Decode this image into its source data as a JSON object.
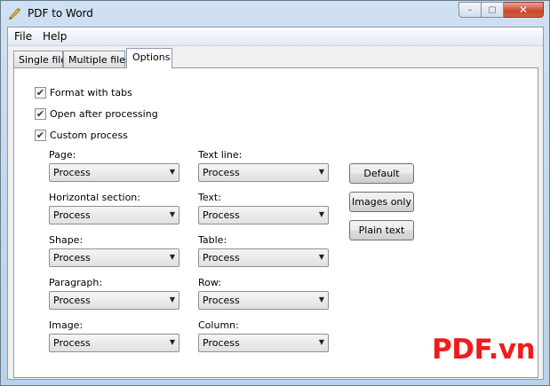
{
  "window": {
    "title": "PDF to Word"
  },
  "window_controls": {
    "minimize": "–",
    "maximize": "▢",
    "close": "✕"
  },
  "menu": {
    "file": "File",
    "help": "Help"
  },
  "tabs": [
    {
      "label": "Single file"
    },
    {
      "label": "Multiple files"
    },
    {
      "label": "Options",
      "active": true
    }
  ],
  "options": {
    "format_with_tabs": {
      "label": "Format with tabs",
      "checked": true
    },
    "open_after_processing": {
      "label": "Open after processing",
      "checked": true
    },
    "custom_process": {
      "label": "Custom process",
      "checked": true
    }
  },
  "check_mark": "✔",
  "combo_arrow": "▼",
  "fields_left": [
    {
      "label": "Page:",
      "value": "Process"
    },
    {
      "label": "Horizontal section:",
      "value": "Process"
    },
    {
      "label": "Shape:",
      "value": "Process"
    },
    {
      "label": "Paragraph:",
      "value": "Process"
    },
    {
      "label": "Image:",
      "value": "Process"
    }
  ],
  "fields_right": [
    {
      "label": "Text line:",
      "value": "Process"
    },
    {
      "label": "Text:",
      "value": "Process"
    },
    {
      "label": "Table:",
      "value": "Process"
    },
    {
      "label": "Row:",
      "value": "Process"
    },
    {
      "label": "Column:",
      "value": "Process"
    }
  ],
  "buttons": {
    "default": "Default",
    "images_only": "Images only",
    "plain_text": "Plain text"
  },
  "watermark": "PDF.vn",
  "icons": {
    "app": "pencil-icon"
  },
  "colors": {
    "watermark": "#ee1c1c",
    "close_button": "#c9462c",
    "frame": "#b9d1ea"
  }
}
